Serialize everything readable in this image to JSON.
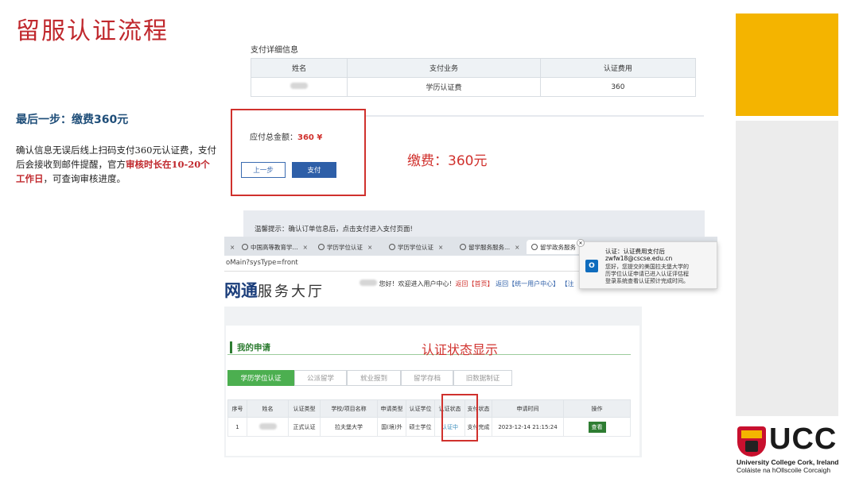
{
  "slide": {
    "title": "留服认证流程",
    "step_heading": "最后一步：缴费360元",
    "desc_1": "确认信息无误后线上扫码支付360元认证费，支付后会接收到邮件提醒，官方",
    "desc_highlight": "审核时长在10-20个工作日",
    "desc_2": "，可查询审核进度。"
  },
  "payment": {
    "section_title": "支付详细信息",
    "headers": [
      "姓名",
      "支付业务",
      "认证费用"
    ],
    "row": [
      "",
      "学历认证费",
      "360"
    ],
    "total_label": "应付总金额：",
    "total_amount": "360 ¥",
    "back_button": "上一步",
    "pay_button": "支付",
    "annotation": "缴费：360元",
    "tip": "温馨提示：确认订单信息后，点击支付进入支付页面!"
  },
  "browser": {
    "tabs": [
      "中国高等教育学...",
      "学历学位认证",
      "学历学位认证",
      "留学服务服务...",
      "留学政务服务"
    ],
    "url": "oMain?sysType=front",
    "brand": "网通",
    "brand_suffix": "服务大厅",
    "welcome": "您好！欢迎进入用户中心！",
    "link_back": "返回【首页】",
    "link_unified": "返回【统一用户中心】",
    "link_extra": "【注"
  },
  "notification": {
    "app_icon": "O",
    "title": "认证：认证费用支付后",
    "sender": "zwfw18@cscse.edu.cn",
    "line_1": "您好，您提交的美国拉夫堡大学的",
    "line_2": "历学位认证申请已进入认证评估程",
    "line_3": "登录系统查看认证预计完成时间。"
  },
  "applications": {
    "heading": "我的申请",
    "annotation": "认证状态显示",
    "tabs": [
      "学历学位认证",
      "公派留学",
      "就业报到",
      "留学存档",
      "旧数据制证"
    ],
    "headers": [
      "序号",
      "姓名",
      "认证类型",
      "学校/项目名称",
      "申请类型",
      "认证学位",
      "认证状态",
      "支付状态",
      "申请时间",
      "操作"
    ],
    "row": [
      "1",
      "",
      "正式认证",
      "拉夫堡大学",
      "国(境)外",
      "硕士学位",
      "认证中",
      "支付完成",
      "2023-12-14 21:15:24",
      "查看"
    ]
  },
  "logo": {
    "name": "UCC",
    "line_1": "University College Cork, Ireland",
    "line_2": "Coláiste na hOllscoile Corcaigh"
  },
  "colors": {
    "accent_red": "#c0282d",
    "heading_blue": "#1f4e79",
    "deco_yellow": "#f4b400",
    "tab_green": "#4caf50"
  }
}
